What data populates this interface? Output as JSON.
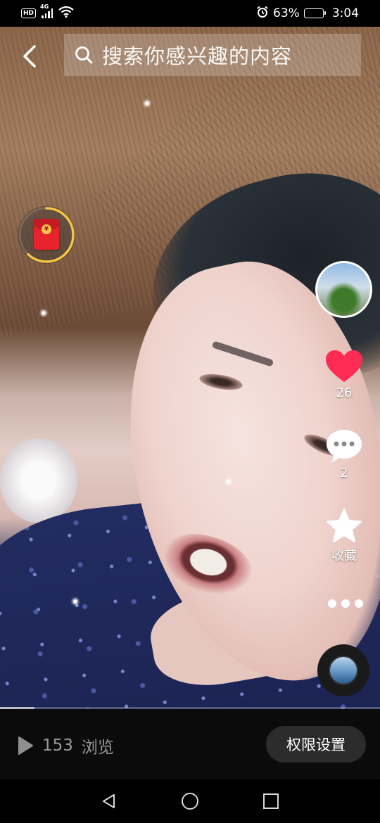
{
  "status_bar": {
    "hd_label": "HD",
    "network_label": "4G",
    "battery_text": "63%",
    "battery_level": 0.63,
    "time": "3:04",
    "icons": [
      "hd-icon",
      "signal-icon",
      "wifi-icon",
      "alarm-icon",
      "battery-icon"
    ]
  },
  "header": {
    "back_icon": "back-arrow-icon",
    "search_icon": "search-icon",
    "search_placeholder": "搜索你感兴趣的内容"
  },
  "red_packet": {
    "icon": "red-envelope-icon",
    "coin_symbol": "¥",
    "progress": 0.62,
    "ring_color": "#f5c542"
  },
  "side_actions": {
    "avatar": "creator-avatar",
    "like": {
      "icon": "heart-icon",
      "count": "26",
      "color": "#fe2c55"
    },
    "comment": {
      "icon": "comment-icon",
      "count": "2"
    },
    "favorite": {
      "icon": "star-icon",
      "label": "收藏"
    },
    "more_icon": "more-dots-icon",
    "music_icon": "music-disc-icon"
  },
  "playback": {
    "progress": 0.09
  },
  "footer": {
    "play_icon": "play-icon",
    "views_count": "153",
    "views_label": "浏览",
    "permission_button": "权限设置"
  },
  "nav_bar": {
    "icons": [
      "back-triangle-icon",
      "home-circle-icon",
      "recents-square-icon"
    ]
  }
}
